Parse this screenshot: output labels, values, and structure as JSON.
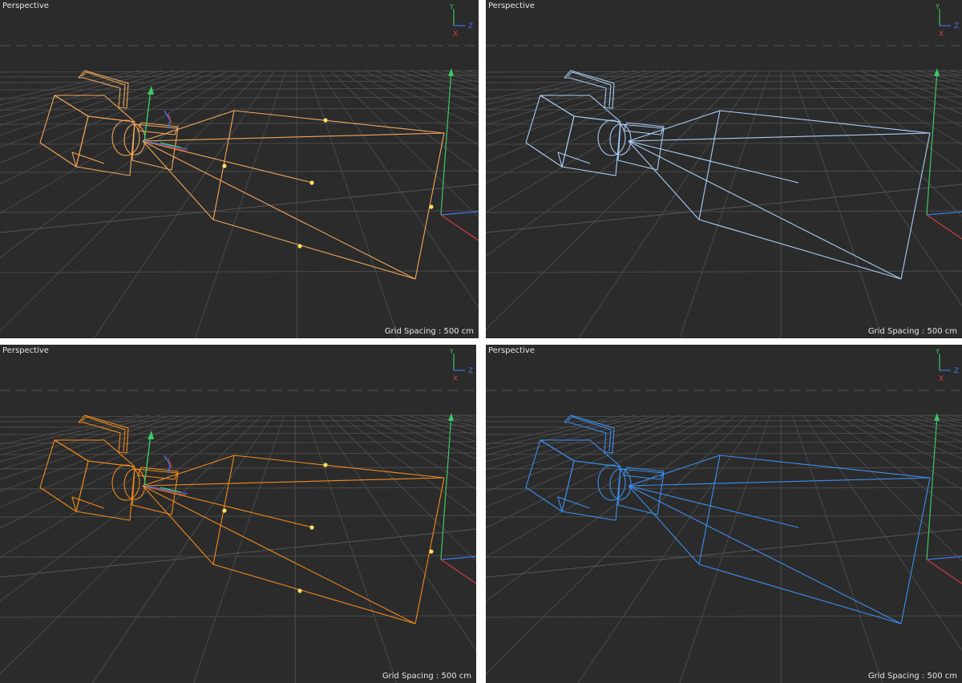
{
  "viewports": [
    {
      "title": "Perspective",
      "grid_spacing": "Grid Spacing : 500 cm",
      "wire_color": "#f2a65a",
      "state": "selected-light"
    },
    {
      "title": "Perspective",
      "grid_spacing": "Grid Spacing : 500 cm",
      "wire_color": "#a8cdf5",
      "state": "unselected-light"
    },
    {
      "title": "Perspective",
      "grid_spacing": "Grid Spacing : 500 cm",
      "wire_color": "#f08a1c",
      "state": "selected"
    },
    {
      "title": "Perspective",
      "grid_spacing": "Grid Spacing : 500 cm",
      "wire_color": "#3a8ff0",
      "state": "unselected"
    }
  ],
  "axis_labels": {
    "y": "Y",
    "z": "Z",
    "x": "X"
  },
  "colors": {
    "viewport_bg": "#2b2b2b",
    "grid": "#4a4a4a",
    "axis_x": "#d23c3c",
    "axis_y": "#3cc864",
    "axis_z": "#3c78e6",
    "handle": "#ffe066"
  }
}
